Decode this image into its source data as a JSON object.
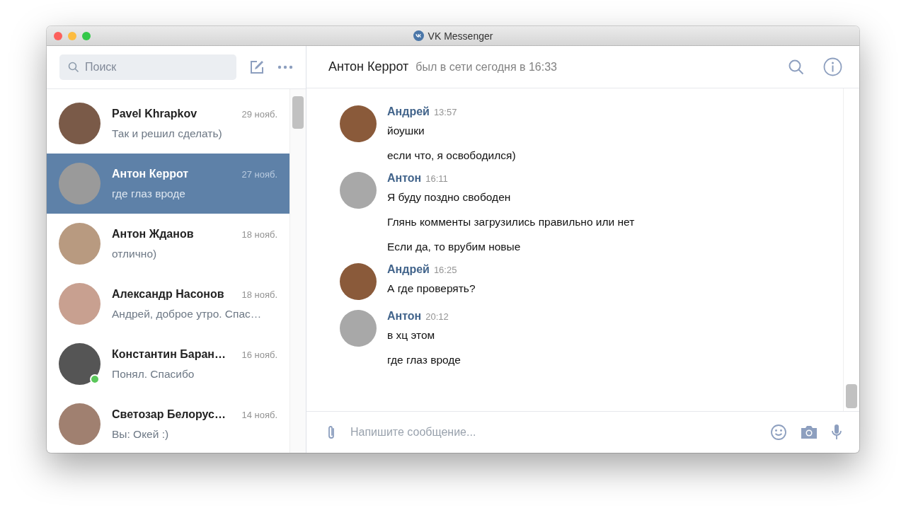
{
  "window": {
    "title": "VK Messenger"
  },
  "search": {
    "placeholder": "Поиск"
  },
  "dialogs": [
    {
      "name": "Pavel Khrapkov",
      "date": "29 нояб.",
      "preview": "Так и решил сделать)",
      "selected": false,
      "online": false
    },
    {
      "name": "Антон Керрот",
      "date": "27 нояб.",
      "preview": "где глаз вроде",
      "selected": true,
      "online": false
    },
    {
      "name": "Антон Жданов",
      "date": "18 нояб.",
      "preview": "отлично)",
      "selected": false,
      "online": false
    },
    {
      "name": "Александр Насонов",
      "date": "18 нояб.",
      "preview": "Андрей, доброе утро. Спас…",
      "selected": false,
      "online": false
    },
    {
      "name": "Константин Баран…",
      "date": "16 нояб.",
      "preview": "Понял. Спасибо",
      "selected": false,
      "online": true
    },
    {
      "name": "Светозар Белорус…",
      "date": "14 нояб.",
      "preview": "Вы: Окей :)",
      "selected": false,
      "online": false
    }
  ],
  "chat": {
    "name": "Антон Керрот",
    "status": "был в сети сегодня в 16:33",
    "messages": [
      {
        "author": "Андрей",
        "time": "13:57",
        "texts": [
          "йоушки",
          "если что, я освободился)"
        ]
      },
      {
        "author": "Антон",
        "time": "16:11",
        "texts": [
          "Я буду поздно свободен",
          "Глянь комменты загрузились правильно или нет",
          "Если да, то врубим новые"
        ]
      },
      {
        "author": "Андрей",
        "time": "16:25",
        "texts": [
          "А где проверять?"
        ]
      },
      {
        "author": "Антон",
        "time": "20:12",
        "texts": [
          "в хц этом",
          "где глаз вроде"
        ]
      }
    ],
    "composer": {
      "placeholder": "Напишите сообщение..."
    }
  }
}
